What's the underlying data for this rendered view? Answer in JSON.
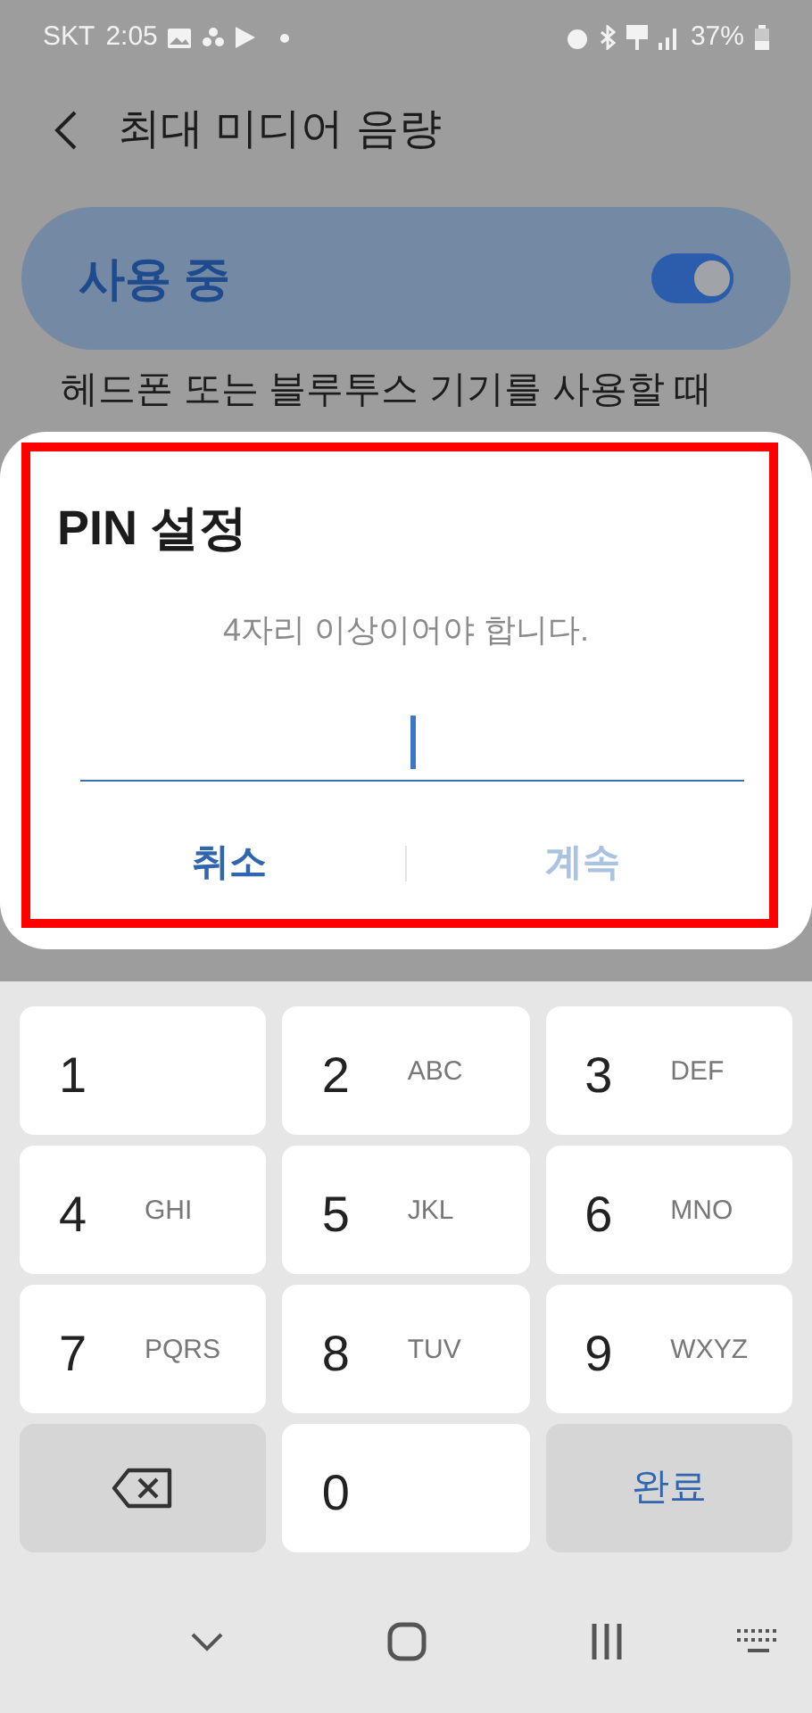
{
  "status_bar": {
    "carrier": "SKT",
    "time": "2:05",
    "battery": "37%"
  },
  "header": {
    "title": "최대 미디어 음량"
  },
  "master_switch": {
    "label": "사용 중",
    "on": true
  },
  "description": "헤드폰 또는 블루투스 기기를 사용할 때",
  "dialog": {
    "title": "PIN 설정",
    "message": "4자리 이상이어야 합니다.",
    "pin_field": {
      "focused": true
    },
    "buttons": [
      {
        "label": "취소",
        "disabled": false
      },
      {
        "label": "계속",
        "disabled": true
      }
    ]
  },
  "keyboard": {
    "keys": [
      {
        "kind": "digit",
        "label": "1"
      },
      {
        "kind": "digit",
        "label": "2",
        "letters": "ABC"
      },
      {
        "kind": "digit",
        "label": "3",
        "letters": "DEF"
      },
      {
        "kind": "digit",
        "label": "4",
        "letters": "GHI"
      },
      {
        "kind": "digit",
        "label": "5",
        "letters": "JKL"
      },
      {
        "kind": "digit",
        "label": "6",
        "letters": "MNO"
      },
      {
        "kind": "digit",
        "label": "7",
        "letters": "PQRS"
      },
      {
        "kind": "digit",
        "label": "8",
        "letters": "TUV"
      },
      {
        "kind": "digit",
        "label": "9",
        "letters": "WXYZ"
      },
      {
        "kind": "backspace"
      },
      {
        "kind": "digit",
        "label": "0"
      },
      {
        "kind": "done",
        "label": "완료"
      }
    ]
  }
}
